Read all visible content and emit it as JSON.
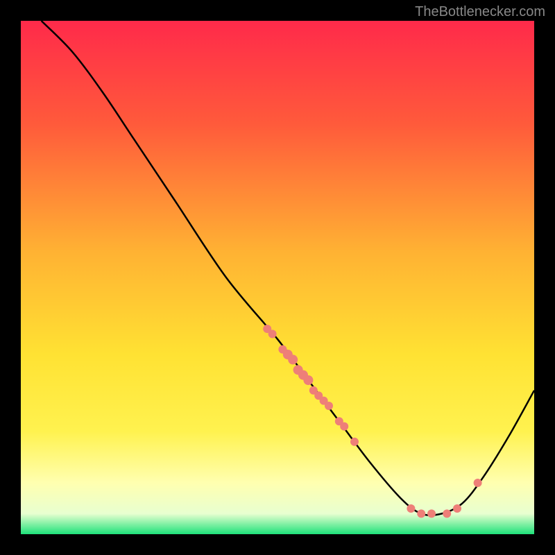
{
  "attribution": "TheBottlenecker.com",
  "chart_data": {
    "type": "line",
    "title": "",
    "xlabel": "",
    "ylabel": "",
    "xlim": [
      0,
      100
    ],
    "ylim": [
      0,
      100
    ],
    "gradient": {
      "stops": [
        {
          "offset": 0,
          "color": "#ff2a4a"
        },
        {
          "offset": 20,
          "color": "#ff5a3b"
        },
        {
          "offset": 45,
          "color": "#ffb233"
        },
        {
          "offset": 65,
          "color": "#ffe233"
        },
        {
          "offset": 80,
          "color": "#fff24f"
        },
        {
          "offset": 90,
          "color": "#ffffb0"
        },
        {
          "offset": 96,
          "color": "#e8ffd0"
        },
        {
          "offset": 100,
          "color": "#1ee27a"
        }
      ]
    },
    "series": [
      {
        "name": "curve",
        "color": "#000000",
        "points": [
          {
            "x": 4,
            "y": 100
          },
          {
            "x": 10,
            "y": 94
          },
          {
            "x": 16,
            "y": 86
          },
          {
            "x": 22,
            "y": 77
          },
          {
            "x": 30,
            "y": 65
          },
          {
            "x": 40,
            "y": 50
          },
          {
            "x": 50,
            "y": 38
          },
          {
            "x": 56,
            "y": 30
          },
          {
            "x": 62,
            "y": 22
          },
          {
            "x": 68,
            "y": 14
          },
          {
            "x": 74,
            "y": 7
          },
          {
            "x": 78,
            "y": 4
          },
          {
            "x": 82,
            "y": 4
          },
          {
            "x": 86,
            "y": 6
          },
          {
            "x": 90,
            "y": 11
          },
          {
            "x": 95,
            "y": 19
          },
          {
            "x": 100,
            "y": 28
          }
        ]
      }
    ],
    "markers": {
      "name": "dots",
      "color": "#ee7f78",
      "points": [
        {
          "x": 48,
          "y": 40,
          "r": 6
        },
        {
          "x": 49,
          "y": 39,
          "r": 6
        },
        {
          "x": 51,
          "y": 36,
          "r": 6
        },
        {
          "x": 52,
          "y": 35,
          "r": 7
        },
        {
          "x": 53,
          "y": 34,
          "r": 7
        },
        {
          "x": 54,
          "y": 32,
          "r": 7
        },
        {
          "x": 55,
          "y": 31,
          "r": 7
        },
        {
          "x": 56,
          "y": 30,
          "r": 7
        },
        {
          "x": 57,
          "y": 28,
          "r": 6
        },
        {
          "x": 58,
          "y": 27,
          "r": 6
        },
        {
          "x": 59,
          "y": 26,
          "r": 6
        },
        {
          "x": 60,
          "y": 25,
          "r": 6
        },
        {
          "x": 62,
          "y": 22,
          "r": 6
        },
        {
          "x": 63,
          "y": 21,
          "r": 6
        },
        {
          "x": 65,
          "y": 18,
          "r": 6
        },
        {
          "x": 76,
          "y": 5,
          "r": 6
        },
        {
          "x": 78,
          "y": 4,
          "r": 6
        },
        {
          "x": 80,
          "y": 4,
          "r": 6
        },
        {
          "x": 83,
          "y": 4,
          "r": 6
        },
        {
          "x": 85,
          "y": 5,
          "r": 6
        },
        {
          "x": 89,
          "y": 10,
          "r": 6
        }
      ]
    }
  }
}
